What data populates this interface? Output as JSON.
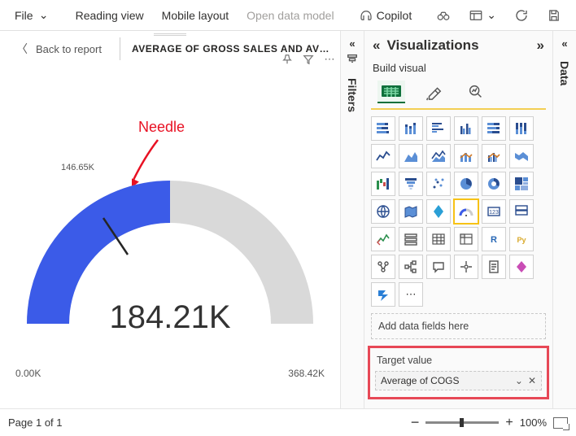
{
  "toolbar": {
    "file": "File",
    "reading": "Reading view",
    "mobile": "Mobile layout",
    "model": "Open data model",
    "copilot": "Copilot"
  },
  "header": {
    "back": "Back to report",
    "title": "AVERAGE OF GROSS SALES AND AVERAG…"
  },
  "annotation": {
    "needle": "Needle"
  },
  "gauge": {
    "value_label": "184.21K",
    "min_label": "0.00K",
    "max_label": "368.42K",
    "target_label": "146.65K"
  },
  "panes": {
    "filters": "Filters",
    "data": "Data",
    "viz_title": "Visualizations",
    "build": "Build visual",
    "add_fields": "Add data fields here",
    "target_value": "Target value",
    "target_field": "Average of COGS"
  },
  "status": {
    "page": "Page 1 of 1",
    "zoom": "100%"
  },
  "chart_data": {
    "type": "gauge",
    "value": 184.21,
    "min": 0.0,
    "max": 368.42,
    "target": 146.65,
    "unit": "K",
    "title": "Average of Gross Sales and Average of COGS"
  }
}
